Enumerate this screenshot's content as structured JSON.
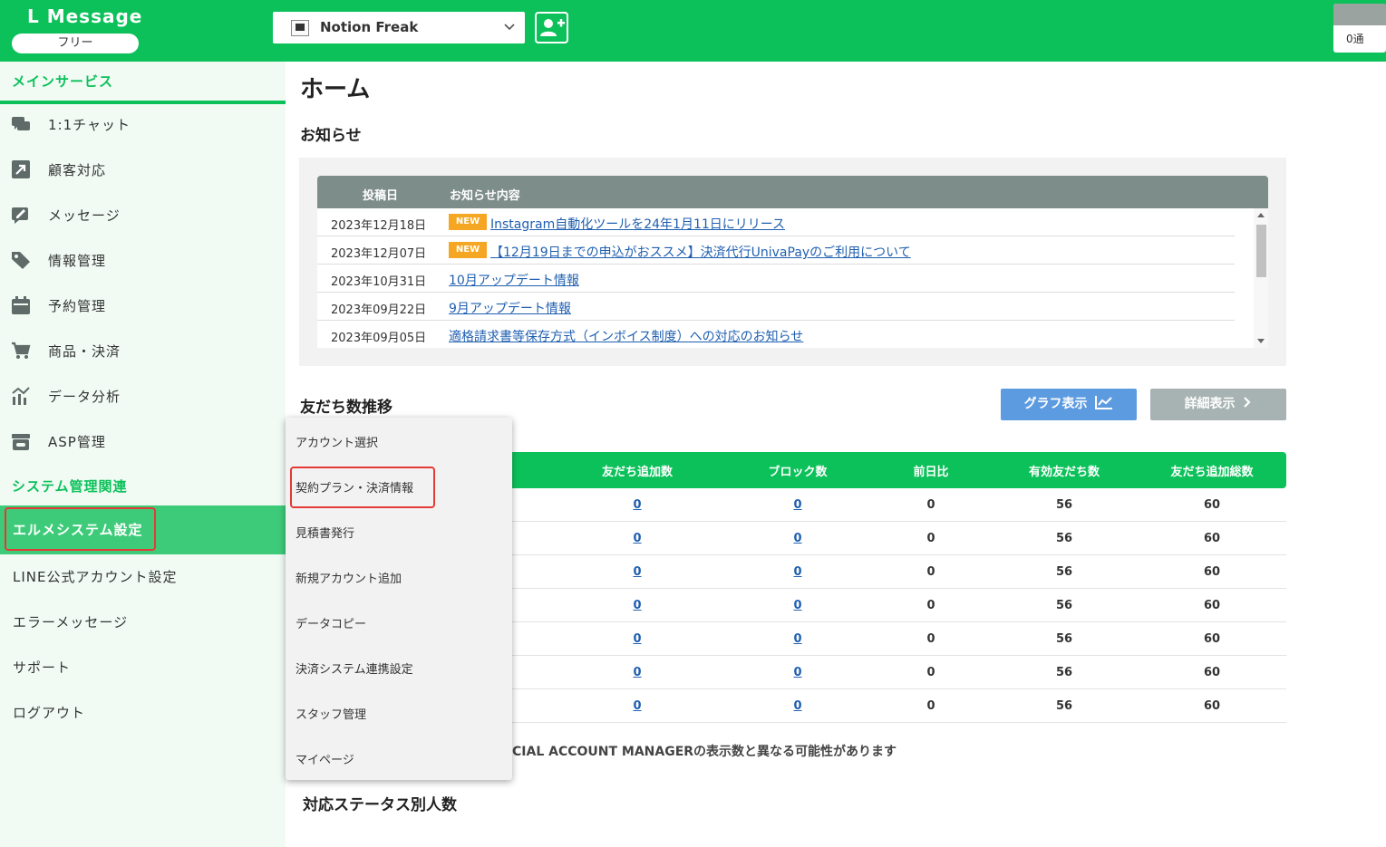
{
  "header": {
    "brand": "L Message",
    "plan": "フリー",
    "account_name": "Notion Freak",
    "count_label": "0通"
  },
  "sidebar": {
    "section_main": "メインサービス",
    "main_items": [
      {
        "label": "1:1チャット",
        "icon": "chat-icon"
      },
      {
        "label": "顧客対応",
        "icon": "arrow-up-right-icon"
      },
      {
        "label": "メッセージ",
        "icon": "edit-message-icon"
      },
      {
        "label": "情報管理",
        "icon": "tag-icon"
      },
      {
        "label": "予約管理",
        "icon": "calendar-icon"
      },
      {
        "label": "商品・決済",
        "icon": "cart-icon"
      },
      {
        "label": "データ分析",
        "icon": "chart-icon"
      },
      {
        "label": "ASP管理",
        "icon": "box-icon"
      }
    ],
    "section_system": "システム管理関連",
    "system_items": [
      "エルメシステム設定",
      "LINE公式アカウント設定",
      "エラーメッセージ",
      "サポート",
      "ログアウト"
    ]
  },
  "main": {
    "title": "ホーム",
    "news_title": "お知らせ",
    "news_headers": [
      "投稿日",
      "お知らせ内容"
    ],
    "news": [
      {
        "date": "2023年12月18日",
        "badge": "NEW",
        "title": "Instagram自動化ツールを24年1月11日にリリース"
      },
      {
        "date": "2023年12月07日",
        "badge": "NEW",
        "title": "【12月19日までの申込がおススメ】決済代行UnivaPayのご利用について"
      },
      {
        "date": "2023年10月31日",
        "badge": "",
        "title": "10月アップデート情報"
      },
      {
        "date": "2023年09月22日",
        "badge": "",
        "title": "9月アップデート情報"
      },
      {
        "date": "2023年09月05日",
        "badge": "",
        "title": "適格請求書等保存方式（インボイス制度）への対応のお知らせ"
      }
    ],
    "friends_title": "友だち数推移",
    "btn_graph": "グラフ表示",
    "btn_detail": "詳細表示",
    "table_headers": [
      "友だち追加数",
      "ブロック数",
      "前日比",
      "有効友だち数",
      "友だち追加総数"
    ],
    "table_rows": [
      [
        "0",
        "0",
        "0",
        "56",
        "60"
      ],
      [
        "0",
        "0",
        "0",
        "56",
        "60"
      ],
      [
        "0",
        "0",
        "0",
        "56",
        "60"
      ],
      [
        "0",
        "0",
        "0",
        "56",
        "60"
      ],
      [
        "0",
        "0",
        "0",
        "56",
        "60"
      ],
      [
        "0",
        "0",
        "0",
        "56",
        "60"
      ],
      [
        "0",
        "0",
        "0",
        "56",
        "60"
      ]
    ],
    "note": "CIAL ACCOUNT MANAGERの表示数と異なる可能性があります",
    "status_title": "対応ステータス別人数"
  },
  "dropdown": {
    "items": [
      "アカウント選択",
      "契約プラン・決済情報",
      "見積書発行",
      "新規アカウント追加",
      "データコピー",
      "決済システム連携設定",
      "スタッフ管理",
      "マイページ"
    ]
  },
  "colors": {
    "brand_green": "#0cc15a",
    "active_green": "#3ecb79",
    "link_blue": "#1f5fb0",
    "badge_orange": "#f5a623",
    "highlight_red": "#e53935"
  }
}
